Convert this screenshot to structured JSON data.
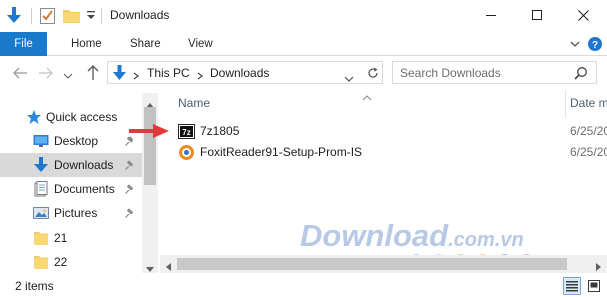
{
  "window": {
    "title": "Downloads",
    "minimize_icon": "minimize-icon",
    "maximize_icon": "maximize-icon",
    "close_icon": "close-icon"
  },
  "quick_access_toolbar": {
    "icons": [
      "download-arrow-icon",
      "properties-icon",
      "new-folder-icon",
      "customize-dropdown-icon"
    ]
  },
  "ribbon": {
    "tabs": [
      {
        "label": "File",
        "active": true
      },
      {
        "label": "Home"
      },
      {
        "label": "Share"
      },
      {
        "label": "View"
      }
    ]
  },
  "address_bar": {
    "crumbs": [
      "This PC",
      "Downloads"
    ]
  },
  "search": {
    "placeholder": "Search Downloads"
  },
  "nav_pane": {
    "items": [
      {
        "label": "Quick access",
        "icon": "star-icon"
      },
      {
        "label": "Desktop",
        "icon": "desktop-icon",
        "pinned": true
      },
      {
        "label": "Downloads",
        "icon": "download-arrow-icon",
        "pinned": true,
        "selected": true
      },
      {
        "label": "Documents",
        "icon": "documents-icon",
        "pinned": true
      },
      {
        "label": "Pictures",
        "icon": "pictures-icon",
        "pinned": true
      },
      {
        "label": "21",
        "icon": "folder-icon"
      },
      {
        "label": "22",
        "icon": "folder-icon"
      }
    ]
  },
  "file_list": {
    "columns": {
      "name": "Name",
      "date": "Date m"
    },
    "rows": [
      {
        "name": "7z1805",
        "date": "6/25/20",
        "icon": "7zip-icon"
      },
      {
        "name": "FoxitReader91-Setup-Prom-IS",
        "date": "6/25/20",
        "icon": "foxit-icon"
      }
    ]
  },
  "watermark": {
    "main": "Download",
    "suffix": ".com.vn",
    "dot_colors": [
      "#8ec6e8",
      "#c9c9c9",
      "#9ad16b",
      "#f7b35c",
      "#56a7e0",
      "#f08a8a"
    ]
  },
  "status_bar": {
    "item_count": "2 items"
  },
  "colors": {
    "file_tab": "#1979ca",
    "selected_nav": "#d9d9d9",
    "annotation_arrow": "#e23a3a"
  }
}
